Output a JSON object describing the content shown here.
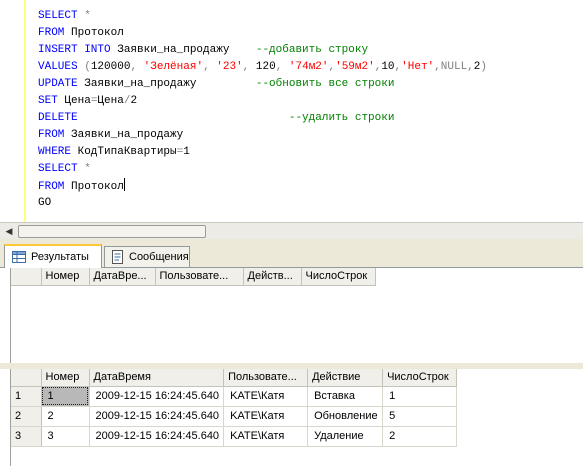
{
  "editor": {
    "lines": [
      [
        {
          "t": "SELECT ",
          "c": "kw"
        },
        {
          "t": "*",
          "c": "gy"
        }
      ],
      [
        {
          "t": "FROM ",
          "c": "kw"
        },
        {
          "t": "Протокол",
          "c": ""
        }
      ],
      [
        {
          "t": "INSERT INTO ",
          "c": "kw"
        },
        {
          "t": "Заявки_на_продажу    ",
          "c": ""
        },
        {
          "t": "--добавить строку",
          "c": "cm"
        }
      ],
      [
        {
          "t": "VALUES ",
          "c": "kw"
        },
        {
          "t": "(",
          "c": "gy"
        },
        {
          "t": "120000",
          "c": ""
        },
        {
          "t": ", ",
          "c": "gy"
        },
        {
          "t": "'Зелёная'",
          "c": "str"
        },
        {
          "t": ", ",
          "c": "gy"
        },
        {
          "t": "'23'",
          "c": "str"
        },
        {
          "t": ", ",
          "c": "gy"
        },
        {
          "t": "120",
          "c": ""
        },
        {
          "t": ", ",
          "c": "gy"
        },
        {
          "t": "'74м2'",
          "c": "str"
        },
        {
          "t": ",",
          "c": "gy"
        },
        {
          "t": "'59м2'",
          "c": "str"
        },
        {
          "t": ",",
          "c": "gy"
        },
        {
          "t": "10",
          "c": ""
        },
        {
          "t": ",",
          "c": "gy"
        },
        {
          "t": "'Нет'",
          "c": "str"
        },
        {
          "t": ",",
          "c": "gy"
        },
        {
          "t": "NULL",
          "c": "gy"
        },
        {
          "t": ",",
          "c": "gy"
        },
        {
          "t": "2",
          "c": ""
        },
        {
          "t": ")",
          "c": "gy"
        }
      ],
      [
        {
          "t": "UPDATE ",
          "c": "kw"
        },
        {
          "t": "Заявки_на_продажу         ",
          "c": ""
        },
        {
          "t": "--обновить все строки",
          "c": "cm"
        }
      ],
      [
        {
          "t": "SET ",
          "c": "kw"
        },
        {
          "t": "Цена",
          "c": ""
        },
        {
          "t": "=",
          "c": "gy"
        },
        {
          "t": "Цена",
          "c": ""
        },
        {
          "t": "/",
          "c": "gy"
        },
        {
          "t": "2",
          "c": ""
        }
      ],
      [
        {
          "t": "DELETE                                ",
          "c": "kw"
        },
        {
          "t": "--удалить строки",
          "c": "cm"
        }
      ],
      [
        {
          "t": "FROM ",
          "c": "kw"
        },
        {
          "t": "Заявки_на_продажу",
          "c": ""
        }
      ],
      [
        {
          "t": "WHERE ",
          "c": "kw"
        },
        {
          "t": "КодТипаКвартиры",
          "c": ""
        },
        {
          "t": "=",
          "c": "gy"
        },
        {
          "t": "1",
          "c": ""
        }
      ],
      [
        {
          "t": "SELECT ",
          "c": "kw"
        },
        {
          "t": "*",
          "c": "gy"
        }
      ],
      [
        {
          "t": "FROM ",
          "c": "kw"
        },
        {
          "t": "Протокол",
          "c": "",
          "caret": true
        }
      ],
      [
        {
          "t": "GO",
          "c": ""
        }
      ]
    ]
  },
  "tabs": {
    "results_label": "Результаты",
    "messages_label": "Сообщения"
  },
  "grid1": {
    "columns": [
      "Номер",
      "ДатаВре...",
      "Пользовате...",
      "Действ...",
      "ЧислоСтрок"
    ]
  },
  "grid2": {
    "columns": [
      "Номер",
      "ДатаВремя",
      "Пользовате...",
      "Действие",
      "ЧислоСтрок"
    ],
    "rows": [
      {
        "n": "1",
        "cells": [
          "1",
          "2009-12-15 16:24:45.640",
          "KATE\\Катя",
          "Вставка",
          "1"
        ]
      },
      {
        "n": "2",
        "cells": [
          "2",
          "2009-12-15 16:24:45.640",
          "KATE\\Катя",
          "Обновление",
          "5"
        ]
      },
      {
        "n": "3",
        "cells": [
          "3",
          "2009-12-15 16:24:45.640",
          "KATE\\Катя",
          "Удаление",
          "2"
        ]
      }
    ]
  },
  "icons": {
    "results": "grid-icon",
    "messages": "messages-icon"
  }
}
